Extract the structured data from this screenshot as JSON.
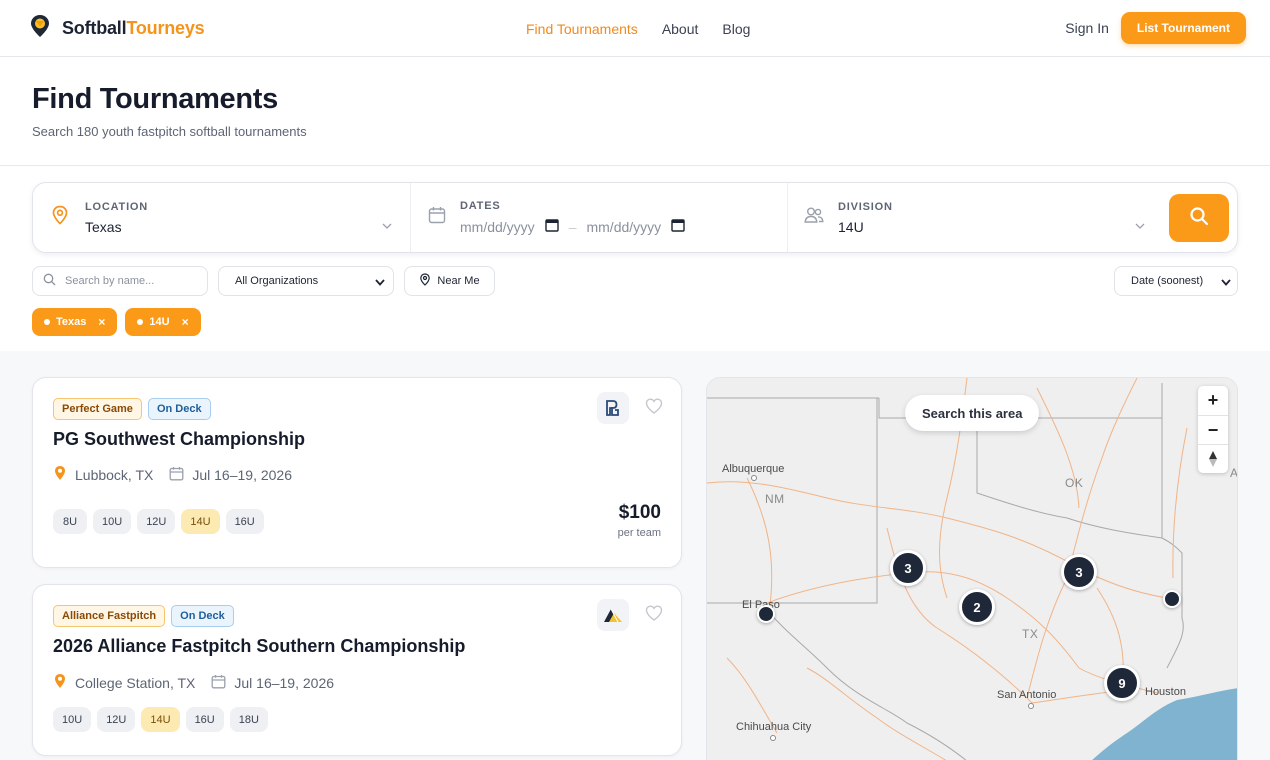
{
  "nav": {
    "brand_part1": "Softball",
    "brand_part2": "Tourneys",
    "links": [
      "Find Tournaments",
      "About",
      "Blog"
    ],
    "sign_in": "Sign In",
    "list_button": "List Tournament"
  },
  "hero": {
    "title": "Find Tournaments",
    "subtitle": "Search 180 youth fastpitch softball tournaments"
  },
  "search": {
    "location_label": "LOCATION",
    "location_value": "Texas",
    "dates_label": "DATES",
    "date_start_placeholder": "mm/dd/yyyy",
    "date_separator": "–",
    "date_end_placeholder": "mm/dd/yyyy",
    "division_label": "DIVISION",
    "division_value": "14U"
  },
  "filters": {
    "name_placeholder": "Search by name...",
    "organization": "All Organizations",
    "near_me": "Near Me",
    "sort": "Date (soonest)"
  },
  "active_chips": [
    "Texas",
    "14U"
  ],
  "chip_remove": "×",
  "tournaments": [
    {
      "org": "Perfect Game",
      "status": "On Deck",
      "title": "PG Southwest Championship",
      "location": "Lubbock, TX",
      "dates": "Jul 16–19, 2026",
      "ages": [
        "8U",
        "10U",
        "12U",
        "14U",
        "16U"
      ],
      "price": "$100",
      "price_unit": "per team",
      "logo_text": "PG"
    },
    {
      "org": "Alliance Fastpitch",
      "status": "On Deck",
      "title": "2026 Alliance Fastpitch Southern Championship",
      "location": "College Station, TX",
      "dates": "Jul 16–19, 2026",
      "ages": [
        "10U",
        "12U",
        "14U",
        "16U",
        "18U"
      ]
    }
  ],
  "map": {
    "search_area": "Search this area",
    "zoom_in": "+",
    "zoom_out": "−",
    "reset_north": "⇡",
    "cities": [
      "Albuquerque",
      "El Paso",
      "San Antonio",
      "Houston",
      "Chihuahua City"
    ],
    "states": [
      "NM",
      "OK",
      "TX",
      "A"
    ],
    "clusters": [
      "3",
      "3",
      "2",
      "9"
    ]
  },
  "colors": {
    "accent": "#fb9a18",
    "dark": "#1e2838",
    "water": "#7fb3cf"
  },
  "icons": {
    "brand": "location-pin-icon",
    "location": "map-pin-icon",
    "dates": "calendar-icon",
    "division": "users-icon",
    "search": "search-icon",
    "favorite": "heart-icon"
  }
}
